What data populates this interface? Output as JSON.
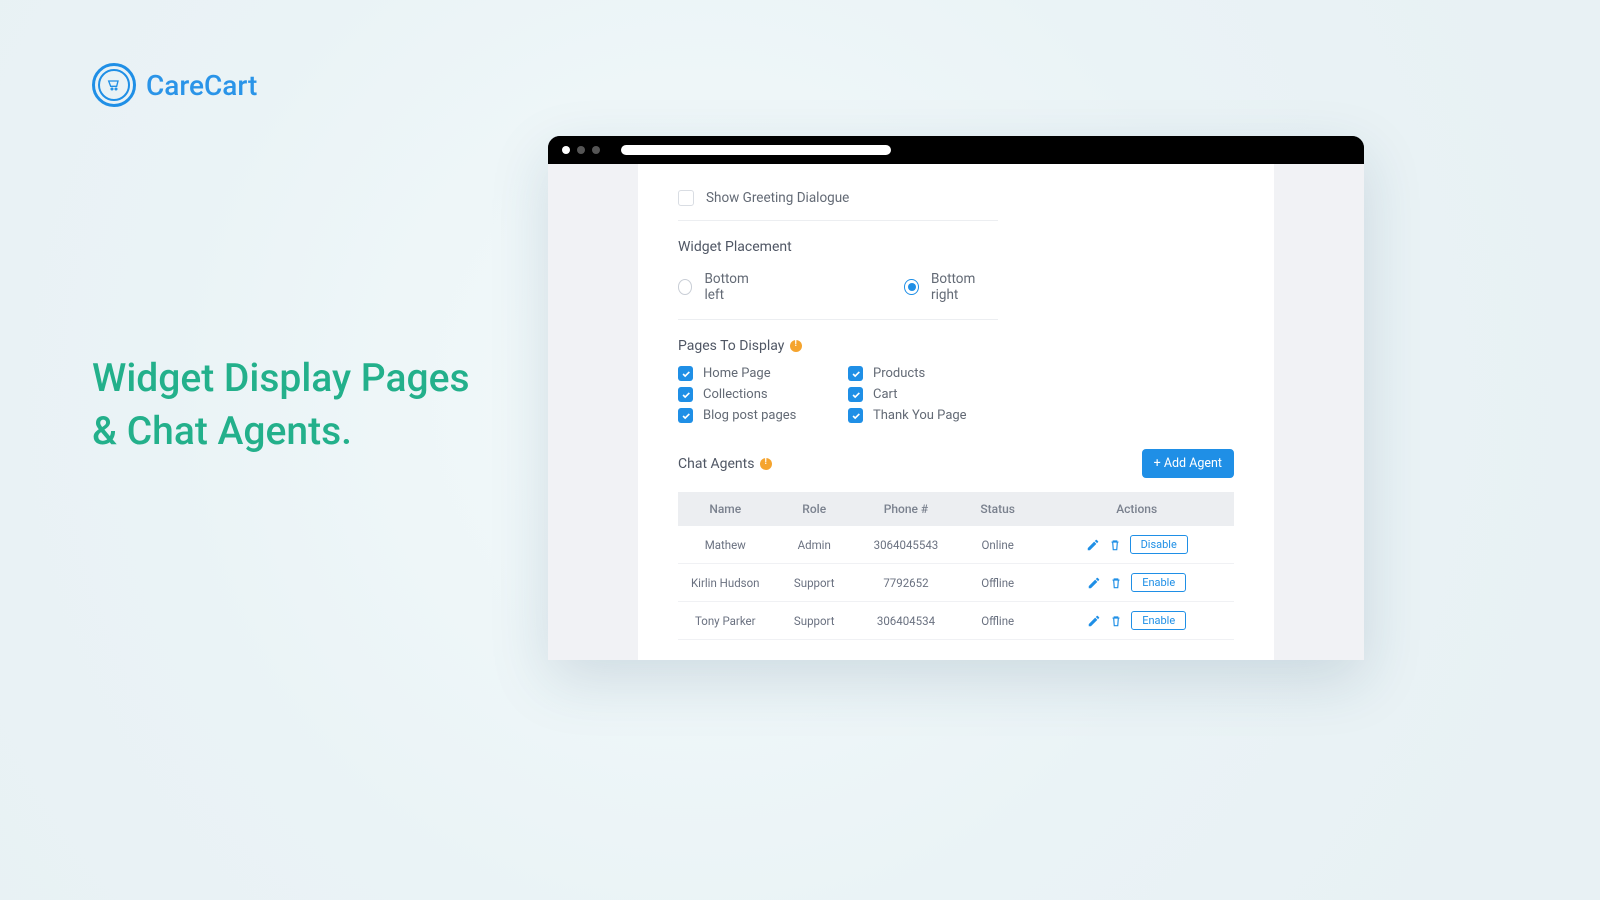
{
  "brand": {
    "name": "CareCart"
  },
  "headline": {
    "line1": "Widget Display Pages",
    "line2": "& Chat Agents."
  },
  "settings": {
    "greeting_label": "Show Greeting Dialogue",
    "placement_title": "Widget Placement",
    "placement_left": "Bottom left",
    "placement_right": "Bottom right",
    "pages_title": "Pages To Display",
    "pages": {
      "home": "Home Page",
      "products": "Products",
      "collections": "Collections",
      "cart": "Cart",
      "blog": "Blog post pages",
      "thankyou": "Thank You Page"
    }
  },
  "agents": {
    "title": "Chat Agents",
    "add_label": "+ Add Agent",
    "cols": {
      "name": "Name",
      "role": "Role",
      "phone": "Phone #",
      "status": "Status",
      "actions": "Actions"
    },
    "rows": [
      {
        "name": "Mathew",
        "role": "Admin",
        "phone": "3064045543",
        "status": "Online",
        "action_label": "Disable"
      },
      {
        "name": "Kirlin Hudson",
        "role": "Support",
        "phone": "7792652",
        "status": "Offline",
        "action_label": "Enable"
      },
      {
        "name": "Tony Parker",
        "role": "Support",
        "phone": "306404534",
        "status": "Offline",
        "action_label": "Enable"
      }
    ]
  }
}
